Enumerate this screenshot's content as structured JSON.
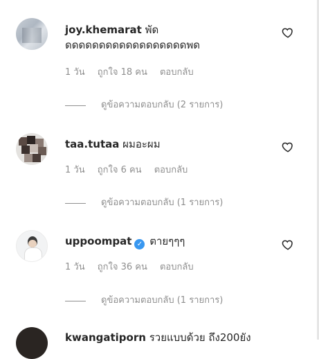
{
  "comments": [
    {
      "username": "joy.khemarat",
      "text": "พัด",
      "text_line2": "ดดดดดดดดดดดดดดดดดดพด",
      "time": "1 วัน",
      "likes": "ถูกใจ 18 คน",
      "reply": "ตอบกลับ",
      "view_replies": "ดูข้อความตอบกลับ (2 รายการ)"
    },
    {
      "username": "taa.tutaa",
      "text": "ผมอะผม",
      "time": "1 วัน",
      "likes": "ถูกใจ 6 คน",
      "reply": "ตอบกลับ",
      "view_replies": "ดูข้อความตอบกลับ (1 รายการ)"
    },
    {
      "username": "uppoompat",
      "text": "ตายๆๆๆ",
      "time": "1 วัน",
      "likes": "ถูกใจ 36 คน",
      "reply": "ตอบกลับ",
      "view_replies": "ดูข้อความตอบกลับ (1 รายการ)",
      "verified": true
    },
    {
      "username": "kwangatiporn",
      "text": "รวยแบบด้วย ถึง200ยัง"
    }
  ],
  "icons": {
    "like": "heart-outline-icon",
    "verified": "verified-badge-icon"
  },
  "colors": {
    "primary_text": "#262626",
    "secondary_text": "#8e8e8e",
    "verified_blue": "#3897f0"
  }
}
